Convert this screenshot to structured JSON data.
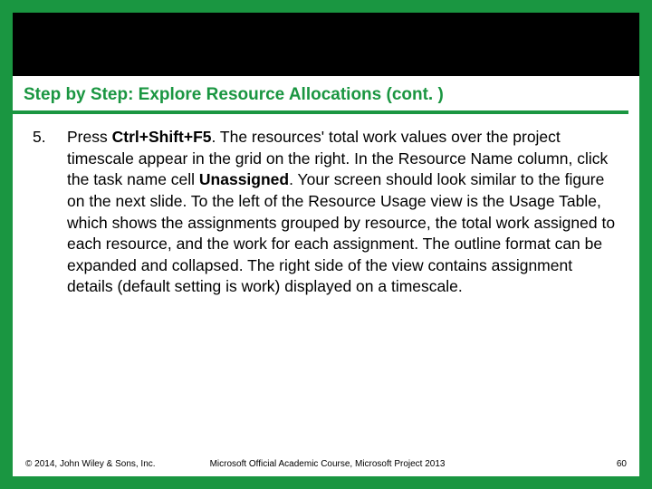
{
  "title": "Step by Step: Explore Resource Allocations (cont. )",
  "list": {
    "start": 5,
    "items": [
      {
        "number": "5.",
        "pre": "Press ",
        "bold1": "Ctrl+Shift+F5",
        "mid": ". The resources' total work values over the project timescale appear in the grid on the right. In the Resource Name column, click the task name cell ",
        "bold2": "Unassigned",
        "post": ". Your screen should look similar to the figure on the next slide. To the left of the Resource Usage view is the Usage Table, which shows the assignments grouped by resource, the total work assigned to each resource, and the work for each assignment. The outline format can be expanded and collapsed. The right side of the view contains assignment details (default setting is work) displayed on a timescale."
      }
    ]
  },
  "footer": {
    "copyright": "© 2014, John Wiley & Sons, Inc.",
    "center": "Microsoft Official Academic Course, Microsoft Project 2013",
    "pagenum": "60"
  }
}
